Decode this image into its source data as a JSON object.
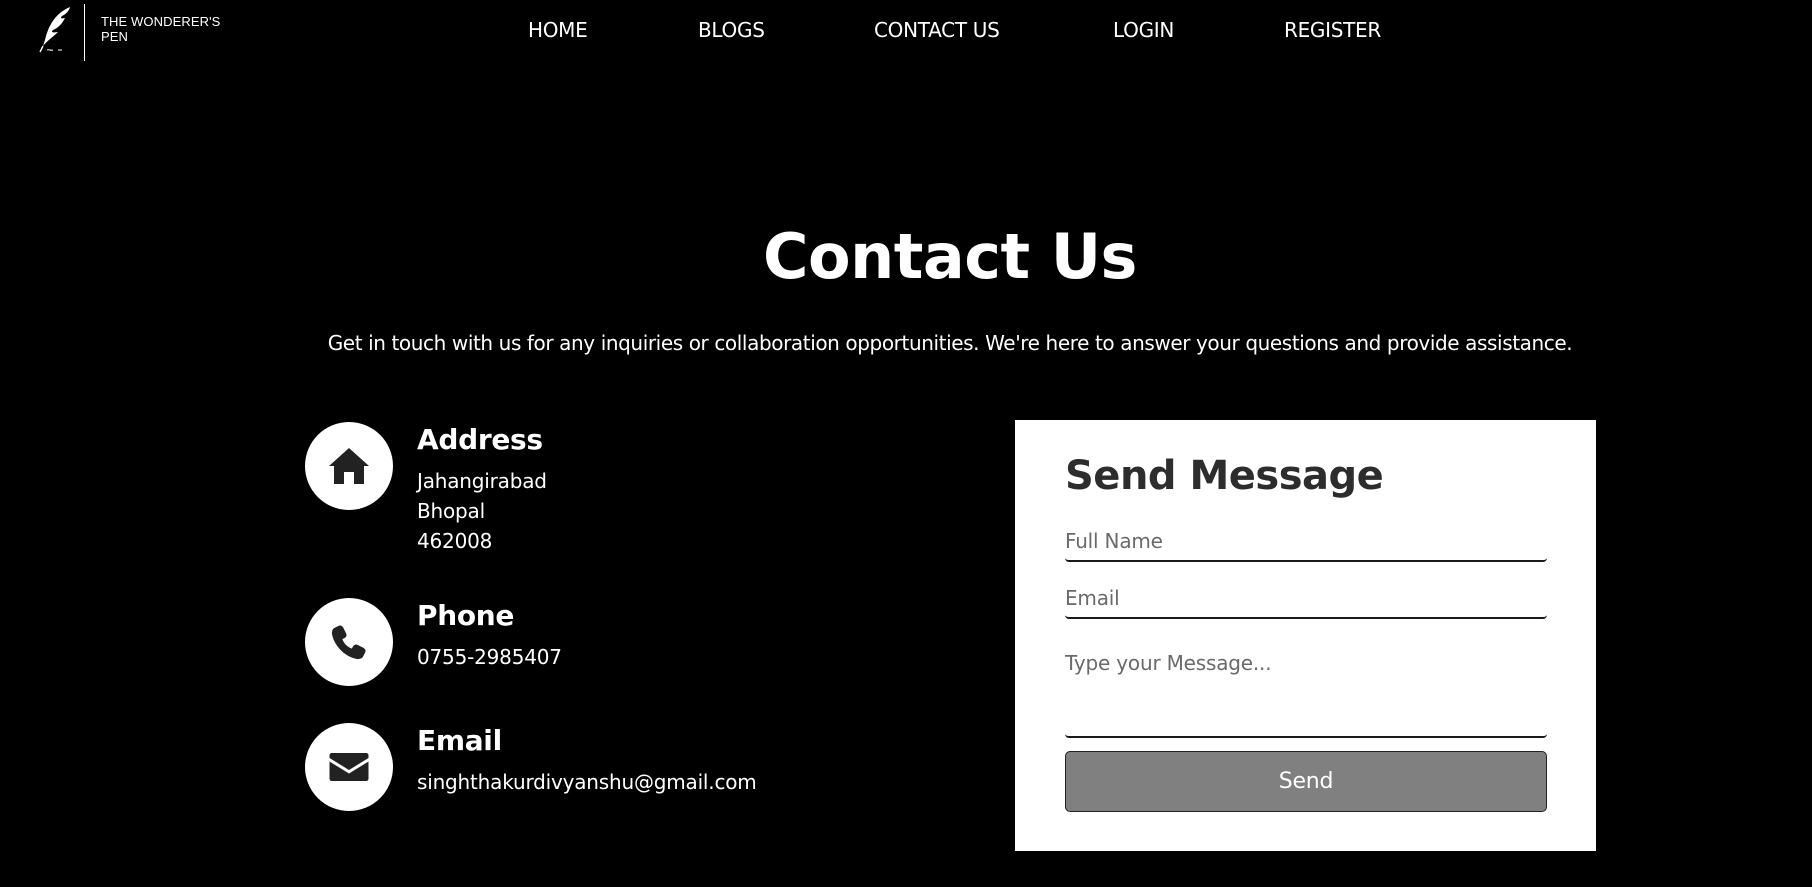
{
  "brand": {
    "name": "THE WONDERER'S PEN",
    "logo_icon": "quill-feather-icon"
  },
  "nav": {
    "items": [
      {
        "label": "HOME"
      },
      {
        "label": "BLOGS"
      },
      {
        "label": "CONTACT US"
      },
      {
        "label": "LOGIN"
      },
      {
        "label": "REGISTER"
      }
    ]
  },
  "page": {
    "title": "Contact Us",
    "subtitle": "Get in touch with us for any inquiries or collaboration opportunities. We're here to answer your questions and provide assistance."
  },
  "contact": {
    "address": {
      "heading": "Address",
      "icon": "house-icon",
      "lines": [
        "Jahangirabad",
        "Bhopal",
        "462008"
      ]
    },
    "phone": {
      "heading": "Phone",
      "icon": "phone-icon",
      "value": "0755-2985407"
    },
    "email": {
      "heading": "Email",
      "icon": "envelope-icon",
      "value": "singhthakurdivyanshu@gmail.com"
    }
  },
  "form": {
    "title": "Send Message",
    "name_placeholder": "Full Name",
    "email_placeholder": "Email",
    "message_placeholder": "Type your Message...",
    "name_value": "",
    "email_value": "",
    "message_value": "",
    "send_label": "Send"
  },
  "colors": {
    "background": "#000000",
    "text": "#ffffff",
    "card_background": "#ffffff",
    "button_background": "#808080",
    "icon_dark": "#222222"
  }
}
